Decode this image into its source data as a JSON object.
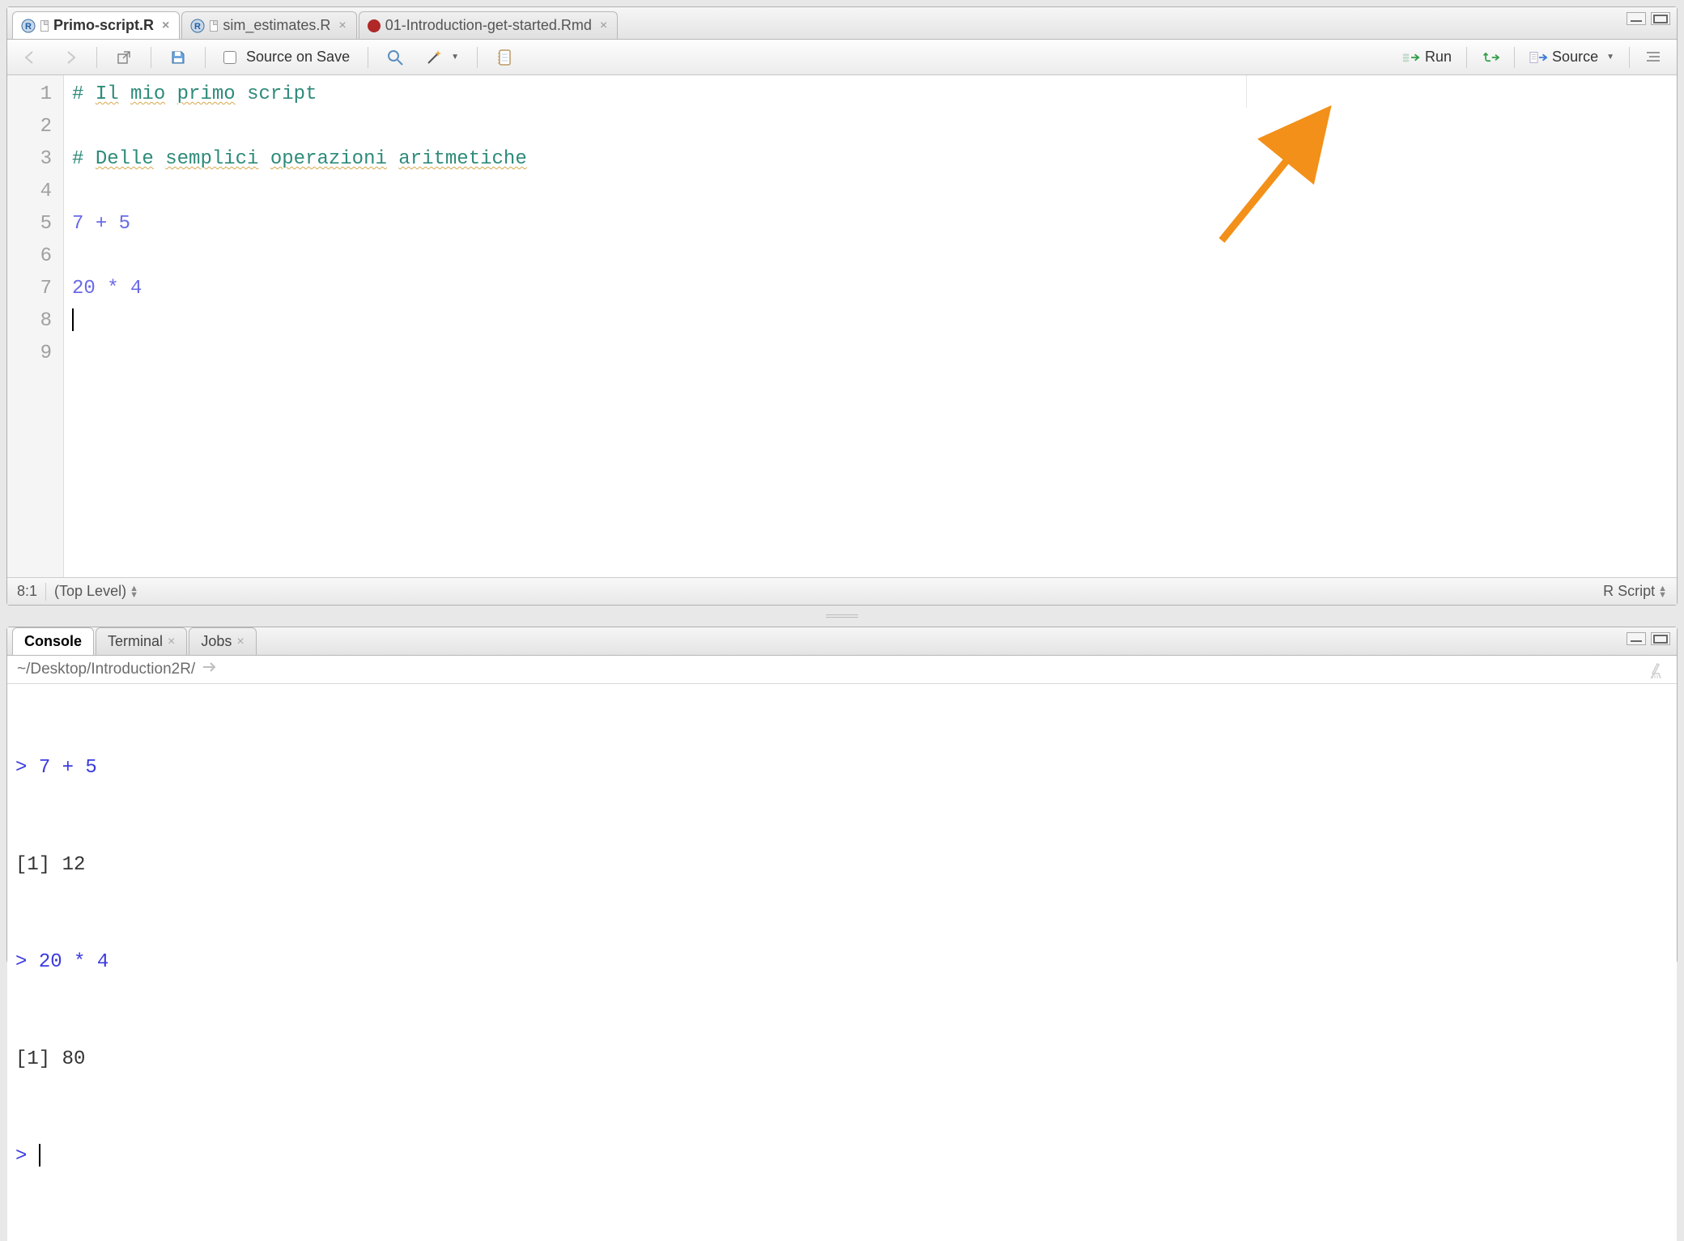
{
  "tabs": [
    {
      "label": "Primo-script.R",
      "type": "r",
      "active": true
    },
    {
      "label": "sim_estimates.R",
      "type": "r",
      "active": false
    },
    {
      "label": "01-Introduction-get-started.Rmd",
      "type": "rmd",
      "active": false
    }
  ],
  "toolbar": {
    "source_on_save": "Source on Save",
    "run": "Run",
    "source": "Source"
  },
  "code": {
    "lines": [
      "1",
      "2",
      "3",
      "4",
      "5",
      "6",
      "7",
      "8",
      "9"
    ],
    "l1_hash": "#",
    "l1_w1": "Il",
    "l1_w2": "mio",
    "l1_w3": "primo",
    "l1_w4": "script",
    "l3_hash": "#",
    "l3_w1": "Delle",
    "l3_w2": "semplici",
    "l3_w3": "operazioni",
    "l3_w4": "aritmetiche",
    "l5_a": "7",
    "l5_op": "+",
    "l5_b": "5",
    "l7_a": "20",
    "l7_op": "*",
    "l7_b": "4"
  },
  "statusbar": {
    "pos": "8:1",
    "scope": "(Top Level)",
    "mode": "R Script"
  },
  "console_tabs": [
    {
      "label": "Console",
      "active": true,
      "closable": false
    },
    {
      "label": "Terminal",
      "active": false,
      "closable": true
    },
    {
      "label": "Jobs",
      "active": false,
      "closable": true
    }
  ],
  "console": {
    "path": "~/Desktop/Introduction2R/",
    "l1_prompt": ">",
    "l1_expr": "7 + 5",
    "l2_out": "[1] 12",
    "l3_prompt": ">",
    "l3_expr": "20 * 4",
    "l4_out": "[1] 80",
    "l5_prompt": ">"
  }
}
